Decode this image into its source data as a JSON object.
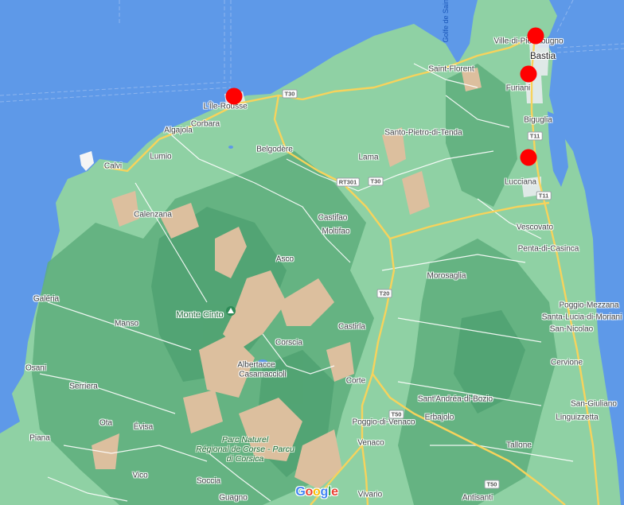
{
  "map": {
    "labels": {
      "bastia": "Bastia",
      "ville_di_pietrabugno": "Ville-di-Pietrabugno",
      "saint_florent": "Saint-Florent",
      "furiani": "Furiani",
      "biguglia": "Biguglia",
      "santo_pietro": "Santo-Pietro-di-Tenda",
      "lucciana": "Lucciana",
      "vescovato": "Vescovato",
      "penta_di_casinca": "Penta-di-Casinca",
      "lile_rousse": "L'Île-Rousse",
      "corbara": "Corbara",
      "algajola": "Algajola",
      "belgodere": "Belgodère",
      "lumio": "Lumio",
      "calvi": "Calvi",
      "lama": "Lama",
      "calenzana": "Calenzana",
      "castifao": "Castifao",
      "moltifao": "Moltifao",
      "asco": "Asco",
      "morosaglia": "Morosaglia",
      "galeria": "Galéria",
      "manso": "Manso",
      "monte_cinto": "Monte Cinto",
      "castirla": "Castirla",
      "corscia": "Corscia",
      "poggio_mezzana": "Poggio-Mezzana",
      "santa_lucia": "Santa-Lucia-di-Moriani",
      "san_nicolao": "San-Nicolao",
      "albertacce": "Albertacce",
      "casamaccioli": "Casamaccioli",
      "osani": "Osani",
      "cervione": "Cervione",
      "serriera": "Serriera",
      "corte": "Corte",
      "sant_andrea": "Sant'Andréa-di-Bozio",
      "san_giuliano": "San-Giuliano",
      "poggio_di_venaco": "Poggio-di-Venaco",
      "erbajolo": "Erbajolo",
      "linguizzetta": "Linguizzetta",
      "ota": "Ota",
      "evisa": "Évisa",
      "venaco": "Venaco",
      "piana": "Piana",
      "tallone": "Tallone",
      "vico": "Vico",
      "soccia": "Soccia",
      "guagno": "Guagno",
      "vivario": "Vivario",
      "antisanti": "Antisanti",
      "golfe_de_saint": "Golfe de Saint",
      "park_line1": "Parc Naturel",
      "park_line2": "Régional de Corse - Parcu",
      "park_line3": "di Corsica"
    },
    "road_shields": {
      "t30_a": "T30",
      "t30_b": "T30",
      "rt301": "RT301",
      "t11_a": "T11",
      "t11_b": "T11",
      "t20": "T20",
      "t50_a": "T50",
      "t50_b": "T50"
    },
    "markers": [
      "marker-1",
      "marker-2",
      "marker-3",
      "marker-4"
    ],
    "logo": {
      "text": "Google",
      "letters": [
        "G",
        "o",
        "o",
        "g",
        "l",
        "e"
      ],
      "colors": [
        "#4285F4",
        "#EA4335",
        "#FBBC05",
        "#4285F4",
        "#34A853",
        "#EA4335"
      ]
    },
    "colors": {
      "water": "#5e99e8",
      "land": "#8fd1a4",
      "mountain": "#5eae7d",
      "rock": "#dcbf9e",
      "road_primary": "#f7d35c",
      "road_secondary": "#ffffff",
      "marker": "#ff0000"
    }
  }
}
